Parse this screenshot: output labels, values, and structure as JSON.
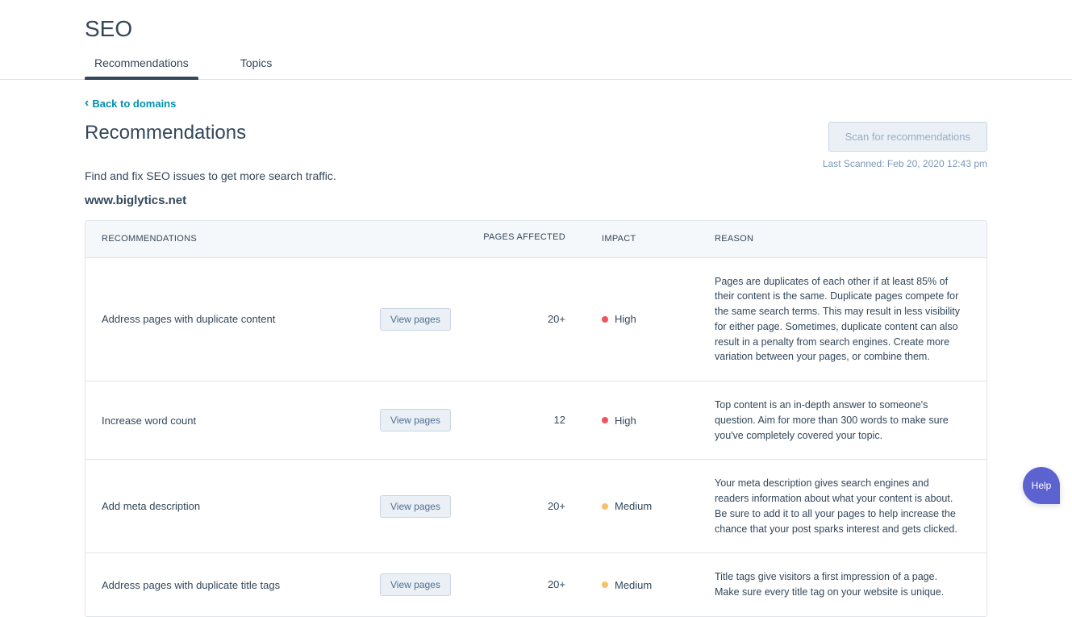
{
  "page_title": "SEO",
  "tabs": [
    {
      "label": "Recommendations",
      "active": true
    },
    {
      "label": "Topics",
      "active": false
    }
  ],
  "back_link": "Back to domains",
  "heading": "Recommendations",
  "scan_button": "Scan for recommendations",
  "last_scanned": "Last Scanned: Feb 20, 2020 12:43 pm",
  "subtitle": "Find and fix SEO issues to get more search traffic.",
  "domain": "www.biglytics.net",
  "columns": {
    "recommendations": "RECOMMENDATIONS",
    "pages_affected": "PAGES AFFECTED",
    "impact": "IMPACT",
    "reason": "REASON"
  },
  "view_pages_label": "View pages",
  "rows": [
    {
      "title": "Address pages with duplicate content",
      "pages": "20+",
      "impact": "High",
      "impact_class": "impact-high",
      "reason": "Pages are duplicates of each other if at least 85% of their content is the same. Duplicate pages compete for the same search terms. This may result in less visibility for either page. Sometimes, duplicate content can also result in a penalty from search engines. Create more variation between your pages, or combine them."
    },
    {
      "title": "Increase word count",
      "pages": "12",
      "impact": "High",
      "impact_class": "impact-high",
      "reason": "Top content is an in-depth answer to someone's question. Aim for more than 300 words to make sure you've completely covered your topic."
    },
    {
      "title": "Add meta description",
      "pages": "20+",
      "impact": "Medium",
      "impact_class": "impact-medium",
      "reason": "Your meta description gives search engines and readers information about what your content is about. Be sure to add it to all your pages to help increase the chance that your post sparks interest and gets clicked."
    },
    {
      "title": "Address pages with duplicate title tags",
      "pages": "20+",
      "impact": "Medium",
      "impact_class": "impact-medium",
      "reason": "Title tags give visitors a first impression of a page. Make sure every title tag on your website is unique."
    }
  ],
  "help_label": "Help"
}
